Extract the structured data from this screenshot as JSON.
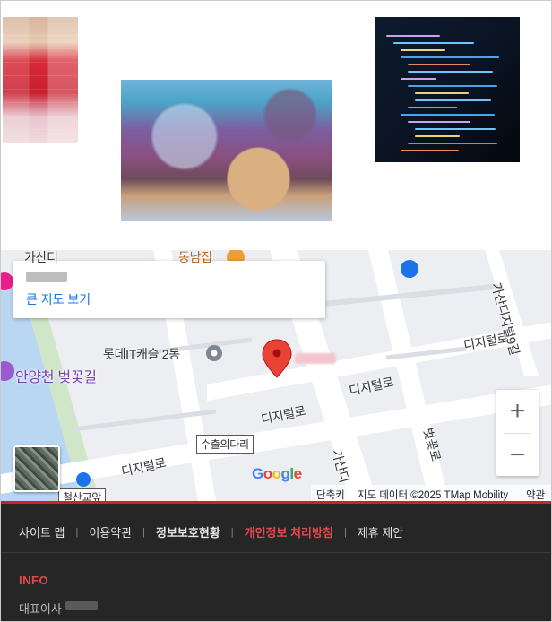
{
  "thumbnails": [
    {
      "name": "thumb-person-red"
    },
    {
      "name": "thumb-colorful-art"
    },
    {
      "name": "thumb-code-screen"
    }
  ],
  "map": {
    "big_map_link": "큰 지도 보기",
    "labels": {
      "gasan_top": "가산디",
      "dongnamjip": "동남집",
      "lotte_castle": "롯데IT캐슬 2동",
      "anyangcheon": "안양천 벚꽃길",
      "digital_ro_1": "디지털로",
      "digital_ro_2": "디지털로",
      "digital_ro_3": "디지털로",
      "digital_ro_4": "디지털로",
      "gasan_digital_9": "가산디지털9길",
      "gasan_vertical": "가산디",
      "beotkkot_ro": "벚꽃로",
      "suchul_bridge": "수출의다리",
      "cheongsan": "철산교앞"
    },
    "google": "Google",
    "attribution": {
      "shortcuts": "단축키",
      "map_data": "지도 데이터 ©2025 TMap Mobility",
      "terms": "약관"
    },
    "zoom_in": "+",
    "zoom_out": "−",
    "colors": {
      "pin": "#ea4335",
      "road": "#ffffff",
      "land": "#eceef2"
    }
  },
  "footer": {
    "nav": [
      {
        "label": "사이트 맵",
        "style": "normal"
      },
      {
        "label": "이용약관",
        "style": "normal"
      },
      {
        "label": "정보보호현황",
        "style": "bold"
      },
      {
        "label": "개인정보 처리방침",
        "style": "red"
      },
      {
        "label": "제휴 제안",
        "style": "normal"
      }
    ],
    "separator": "|",
    "info_heading": "INFO",
    "ceo_label": "대표이사",
    "accent_color": "#c4242b"
  }
}
